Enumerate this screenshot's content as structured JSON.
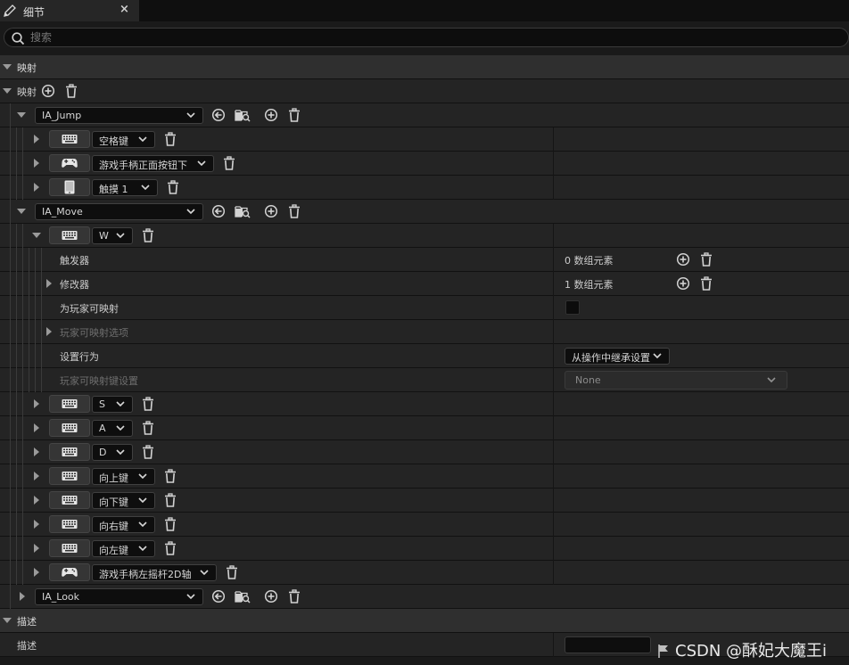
{
  "tab": {
    "title": "细节",
    "close": "×"
  },
  "search": {
    "placeholder": "搜索"
  },
  "categories": {
    "mapping": "映射",
    "description": "描述"
  },
  "mappings_label": "映射",
  "actions": [
    {
      "name": "IA_Jump",
      "keys": [
        {
          "icon": "keyboard-icon",
          "label": "空格键"
        },
        {
          "icon": "gamepad-icon",
          "label": "游戏手柄正面按钮下"
        },
        {
          "icon": "touch-device-icon",
          "label": "触摸 1"
        }
      ]
    },
    {
      "name": "IA_Move",
      "keys": [
        {
          "icon": "keyboard-icon",
          "label": "W"
        },
        {
          "icon": "keyboard-icon",
          "label": "S"
        },
        {
          "icon": "keyboard-icon",
          "label": "A"
        },
        {
          "icon": "keyboard-icon",
          "label": "D"
        },
        {
          "icon": "keyboard-icon",
          "label": "向上键"
        },
        {
          "icon": "keyboard-icon",
          "label": "向下键"
        },
        {
          "icon": "keyboard-icon",
          "label": "向右键"
        },
        {
          "icon": "keyboard-icon",
          "label": "向左键"
        },
        {
          "icon": "gamepad-icon",
          "label": "游戏手柄左摇杆2D轴"
        }
      ]
    },
    {
      "name": "IA_Look",
      "keys": []
    }
  ],
  "w_details": {
    "triggers_label": "触发器",
    "triggers_value": "0 数组元素",
    "modifiers_label": "修改器",
    "modifiers_value": "1 数组元素",
    "player_mappable_label": "为玩家可映射",
    "player_mappable_checked": false,
    "player_mappable_options_label": "玩家可映射选项",
    "setting_behavior_label": "设置行为",
    "setting_behavior_value": "从操作中继承设置",
    "player_mappable_key_settings_label": "玩家可映射键设置",
    "player_mappable_key_settings_value": "None"
  },
  "description": {
    "label": "描述",
    "value": ""
  },
  "watermark": "CSDN @酥妃大魔王i"
}
